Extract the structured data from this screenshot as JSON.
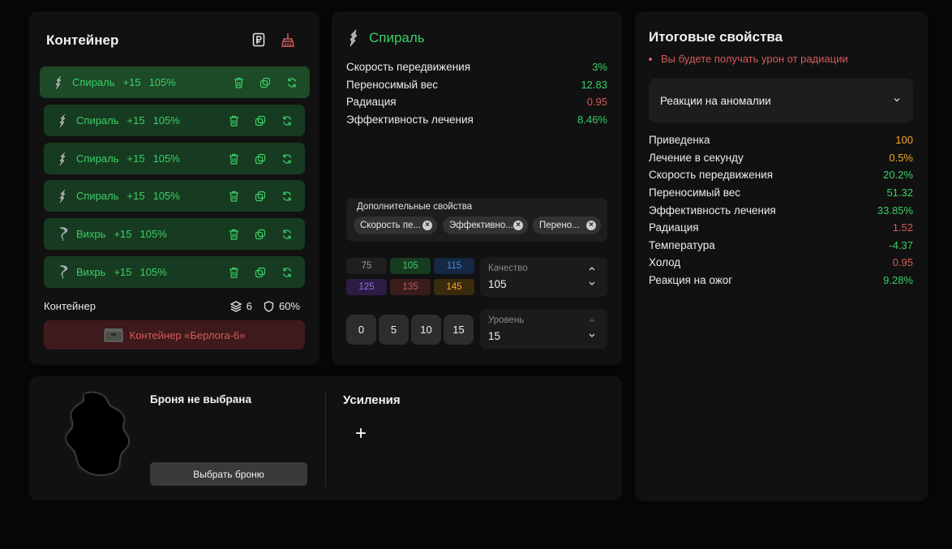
{
  "container": {
    "title": "Контейнер",
    "slots": [
      {
        "name": "Спираль",
        "bonus": "+15",
        "percent": "105%",
        "icon": "spiral-artifact-icon"
      },
      {
        "name": "Спираль",
        "bonus": "+15",
        "percent": "105%",
        "icon": "spiral-artifact-icon"
      },
      {
        "name": "Спираль",
        "bonus": "+15",
        "percent": "105%",
        "icon": "spiral-artifact-icon"
      },
      {
        "name": "Спираль",
        "bonus": "+15",
        "percent": "105%",
        "icon": "spiral-artifact-icon"
      },
      {
        "name": "Вихрь",
        "bonus": "+15",
        "percent": "105%",
        "icon": "whirl-artifact-icon"
      },
      {
        "name": "Вихрь",
        "bonus": "+15",
        "percent": "105%",
        "icon": "whirl-artifact-icon"
      }
    ],
    "footer_label": "Контейнер",
    "slot_count": "6",
    "protection": "60%",
    "container_button": "Контейнер «Берлога-6»"
  },
  "artifact": {
    "name": "Спираль",
    "props": [
      {
        "label": "Скорость передвижения",
        "value": "3%",
        "color": "green"
      },
      {
        "label": "Переносимый вес",
        "value": "12.83",
        "color": "green"
      },
      {
        "label": "Радиация",
        "value": "0.95",
        "color": "red"
      },
      {
        "label": "Эффективность лечения",
        "value": "8.46%",
        "color": "green"
      }
    ],
    "extra_label": "Дополнительные свойства",
    "chips": [
      "Скорость пе...",
      "Эффективно...",
      "Перено..."
    ],
    "quality_options": [
      {
        "value": "75",
        "bg": "#1f1f1f",
        "fg": "#9a9a9a"
      },
      {
        "value": "105",
        "bg": "#173b20",
        "fg": "#3ccf68"
      },
      {
        "value": "115",
        "bg": "#142844",
        "fg": "#4a8be0"
      },
      {
        "value": "125",
        "bg": "#2c1d46",
        "fg": "#9c6ee0"
      },
      {
        "value": "135",
        "bg": "#3a1c1c",
        "fg": "#c45a5a"
      },
      {
        "value": "145",
        "bg": "#3a2a0e",
        "fg": "#f4a62a"
      }
    ],
    "quality_label": "Качество",
    "quality_value": "105",
    "level_options": [
      "0",
      "5",
      "10",
      "15"
    ],
    "level_label": "Уровень",
    "level_value": "15"
  },
  "total": {
    "title": "Итоговые свойства",
    "warning": "Вы будете получать урон от радиации",
    "dropdown_label": "Реакции на аномалии",
    "props": [
      {
        "label": "Приведенка",
        "value": "100",
        "color": "orange"
      },
      {
        "label": "Лечение в секунду",
        "value": "0.5%",
        "color": "orange"
      },
      {
        "label": "Скорость передвижения",
        "value": "20.2%",
        "color": "green"
      },
      {
        "label": "Переносимый вес",
        "value": "51.32",
        "color": "green"
      },
      {
        "label": "Эффективность лечения",
        "value": "33.85%",
        "color": "green"
      },
      {
        "label": "Радиация",
        "value": "1.52",
        "color": "red"
      },
      {
        "label": "Температура",
        "value": "-4.37",
        "color": "green"
      },
      {
        "label": "Холод",
        "value": "0.95",
        "color": "red"
      },
      {
        "label": "Реакция на ожог",
        "value": "9.28%",
        "color": "green"
      }
    ]
  },
  "armor": {
    "title": "Броня не выбрана",
    "select_button": "Выбрать броню",
    "boosts_title": "Усиления",
    "add_symbol": "+"
  },
  "colors": {
    "accent_green": "#3ccf68",
    "danger_red": "#d65a5a",
    "orange": "#f4a62a",
    "panel_bg": "#111111",
    "page_bg": "#060606"
  }
}
